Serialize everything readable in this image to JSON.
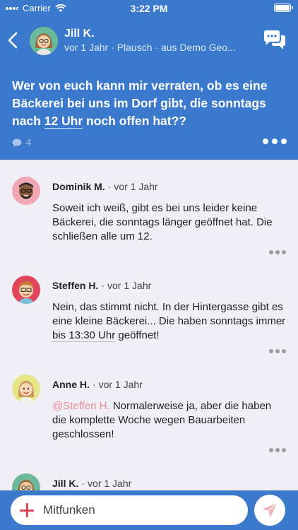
{
  "status_bar": {
    "carrier": "Carrier",
    "time": "3:22 PM"
  },
  "header": {
    "name": "Jill K.",
    "meta": "vor 1 Jahr · Plausch · aus Demo Geo...",
    "post_before": "Wer von euch kann mir verraten, ob es eine Bäckerei bei uns im Dorf gibt, die sonntags nach ",
    "post_link": "12 Uhr",
    "post_after": " noch offen hat??",
    "comment_count": "4"
  },
  "comments": [
    {
      "author": "Dominik M.",
      "separator": "·",
      "ago": "vor 1 Jahr",
      "text": "Soweit ich weiß, gibt es bei uns leider keine Bäckerei, die sonntags länger geöffnet hat. Die schließen alle um 12."
    },
    {
      "author": "Steffen H.",
      "separator": "·",
      "ago": "vor 1 Jahr",
      "text_before": "Nein, das stimmt nicht. In der Hintergasse gibt es eine kleine Bäckerei... Die haben sonntags immer ",
      "text_link": "bis 13:30 Uhr",
      "text_after": " geöffnet!"
    },
    {
      "author": "Anne H.",
      "separator": "·",
      "ago": "vor 1 Jahr",
      "mention": "@Steffen H.",
      "text_after": " Normalerweise ja, aber die haben die komplette Woche wegen Bauarbeiten geschlossen!"
    },
    {
      "author": "Jill K.",
      "separator": "·",
      "ago": "vor 1 Jahr"
    }
  ],
  "composer": {
    "placeholder": "Mitfunken"
  },
  "colors": {
    "brand_blue": "#3a79cc",
    "accent_red": "#e0455b",
    "mention_pink": "#e88a94",
    "background": "#f0eff5"
  },
  "icons": [
    "wifi-icon",
    "battery-icon",
    "back-chevron-icon",
    "chat-bubbles-icon",
    "comment-bubble-icon",
    "more-dots-icon",
    "plus-icon",
    "send-icon"
  ]
}
